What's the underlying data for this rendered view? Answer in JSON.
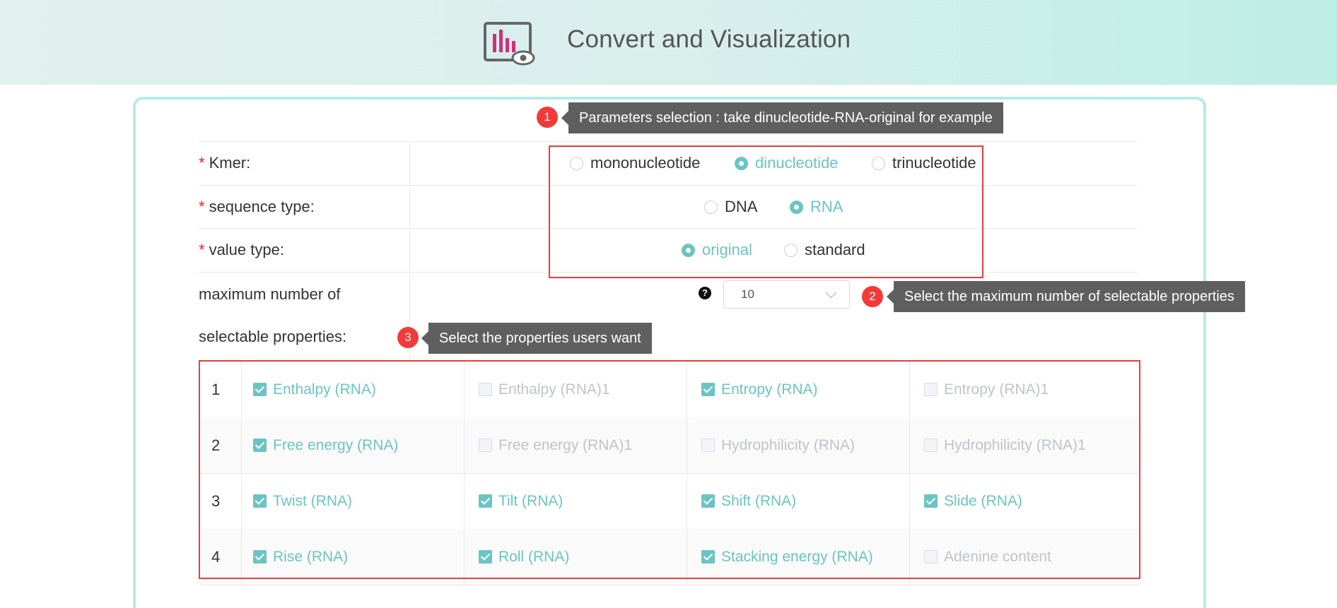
{
  "header": {
    "title": "Convert and Visualization",
    "logo_icon": "chart-eye-icon"
  },
  "tooltips": [
    {
      "badge": "1",
      "text": "Parameters selection : take dinucleotide-RNA-original for example"
    },
    {
      "badge": "2",
      "text": "Select the maximum number of selectable properties"
    },
    {
      "badge": "3",
      "text": "Select the properties users want"
    }
  ],
  "form": {
    "kmer": {
      "label": "Kmer:",
      "options": [
        "mononucleotide",
        "dinucleotide",
        "trinucleotide"
      ],
      "selected": "dinucleotide"
    },
    "sequence_type": {
      "label": "sequence type:",
      "options": [
        "DNA",
        "RNA"
      ],
      "selected": "RNA"
    },
    "value_type": {
      "label": "value type:",
      "options": [
        "original",
        "standard"
      ],
      "selected": "original"
    },
    "max_props": {
      "label_line1": "maximum number of",
      "label_line2": "selectable properties:",
      "value": "10",
      "help_icon": "question-circle-icon"
    },
    "required_mark": "*"
  },
  "properties": {
    "rows": [
      {
        "num": "1",
        "items": [
          {
            "label": "Enthalpy (RNA)",
            "checked": true
          },
          {
            "label": "Enthalpy (RNA)1",
            "checked": false
          },
          {
            "label": "Entropy (RNA)",
            "checked": true
          },
          {
            "label": "Entropy (RNA)1",
            "checked": false
          }
        ]
      },
      {
        "num": "2",
        "items": [
          {
            "label": "Free energy (RNA)",
            "checked": true
          },
          {
            "label": "Free energy (RNA)1",
            "checked": false
          },
          {
            "label": "Hydrophilicity (RNA)",
            "checked": false
          },
          {
            "label": "Hydrophilicity (RNA)1",
            "checked": false
          }
        ]
      },
      {
        "num": "3",
        "items": [
          {
            "label": "Twist (RNA)",
            "checked": true
          },
          {
            "label": "Tilt (RNA)",
            "checked": true
          },
          {
            "label": "Shift (RNA)",
            "checked": true
          },
          {
            "label": "Slide (RNA)",
            "checked": true
          }
        ]
      },
      {
        "num": "4",
        "items": [
          {
            "label": "Rise (RNA)",
            "checked": true
          },
          {
            "label": "Roll (RNA)",
            "checked": true
          },
          {
            "label": "Stacking energy (RNA)",
            "checked": true
          },
          {
            "label": "Adenine content",
            "checked": false
          }
        ]
      }
    ]
  },
  "colors": {
    "accent": "#6cc4c2",
    "annotation_red": "#e83d3d",
    "tooltip_bg": "#5f5f5f"
  }
}
